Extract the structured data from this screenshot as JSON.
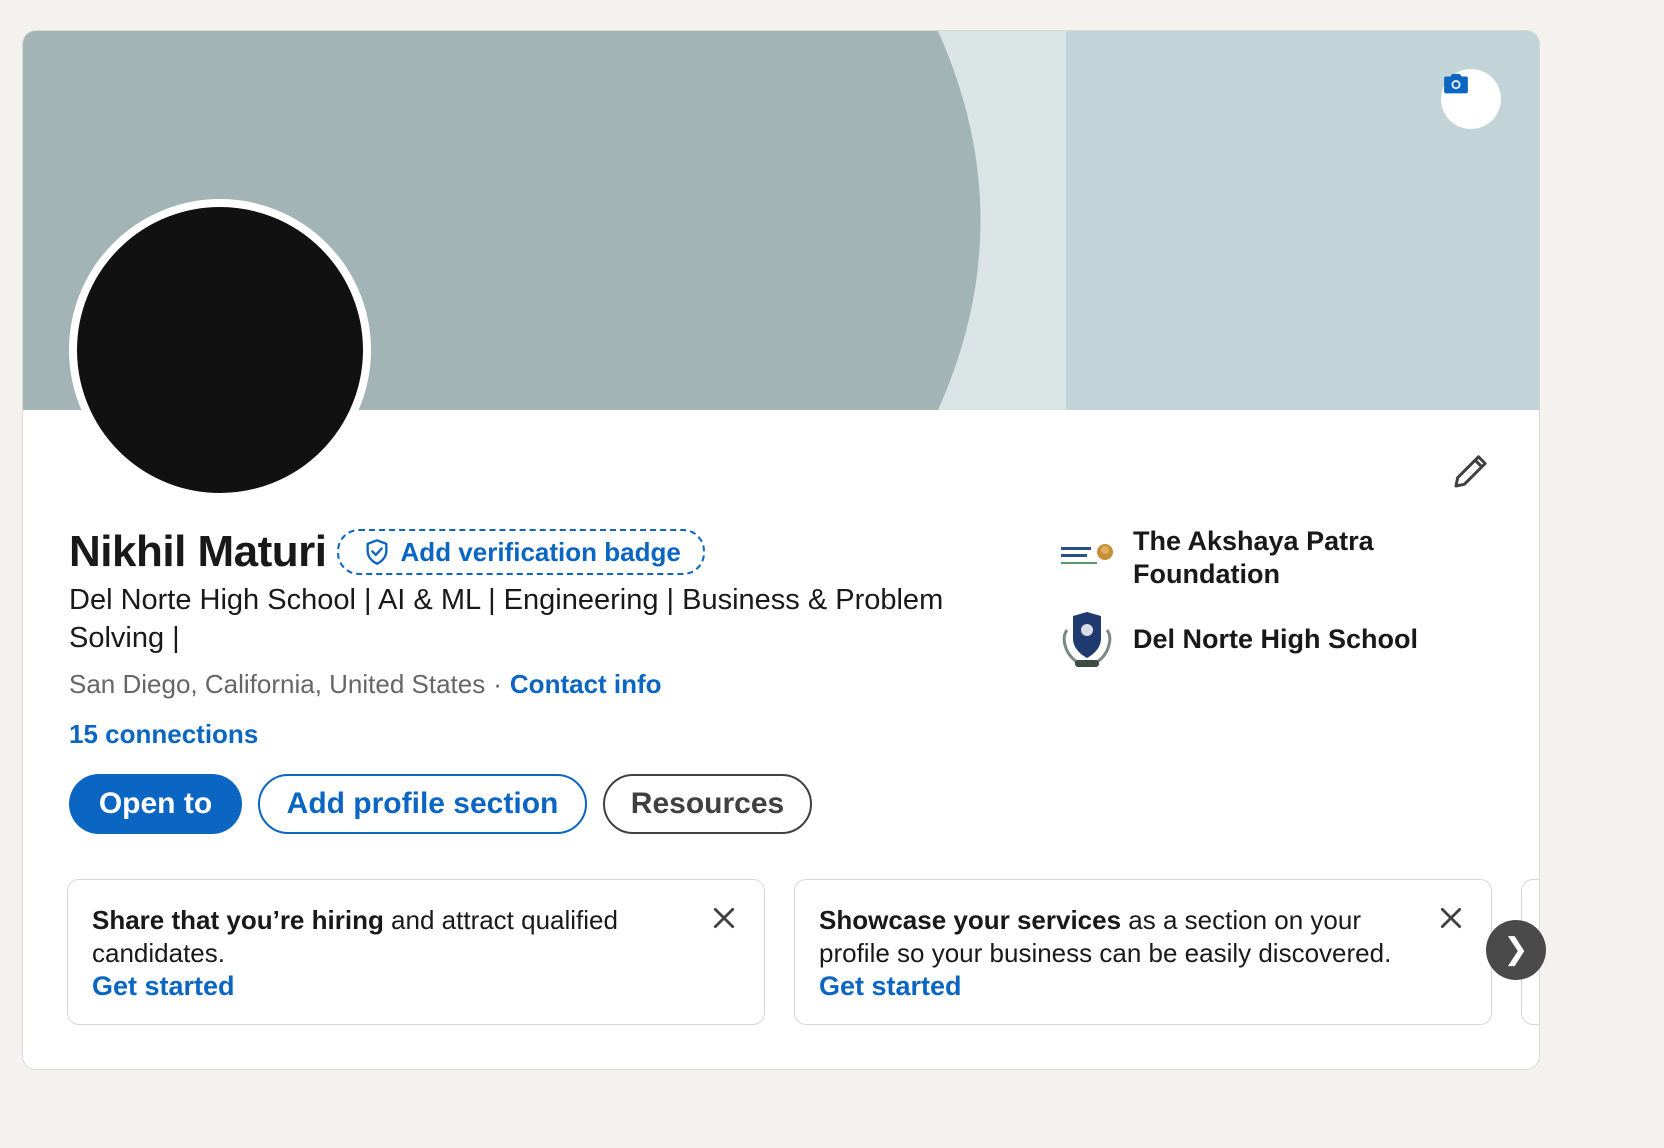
{
  "profile": {
    "name": "Nikhil Maturi",
    "verification_label": "Add verification badge",
    "headline": "Del Norte High School | AI & ML | Engineering | Business & Problem Solving |",
    "location": "San Diego, California, United States",
    "separator": "·",
    "contact_label": "Contact info",
    "connections": "15 connections"
  },
  "actions": {
    "open_to": "Open to",
    "add_section": "Add profile section",
    "resources": "Resources"
  },
  "organizations": [
    {
      "name": "The Akshaya Patra Foundation",
      "logo": "akshaya-patra-logo"
    },
    {
      "name": "Del Norte High School",
      "logo": "del-norte-crest-logo"
    }
  ],
  "promos": [
    {
      "bold": "Share that you’re hiring",
      "rest": " and attract qualified candidates.",
      "link": "Get started"
    },
    {
      "bold": "Showcase your services",
      "rest": " as a section on your profile so your business can be easily discovered.",
      "link": "Get started"
    }
  ],
  "icons": {
    "camera": "camera-icon",
    "edit": "pencil-icon",
    "shield": "shield-check-icon",
    "close": "close-icon",
    "next": "chevron-right-icon",
    "next_glyph": "❯"
  },
  "colors": {
    "brand_blue": "#0a66c2",
    "banner_base": "#c2d4d7",
    "banner_arc": "#a3b4b7",
    "banner_mid": "#dae4e5"
  }
}
